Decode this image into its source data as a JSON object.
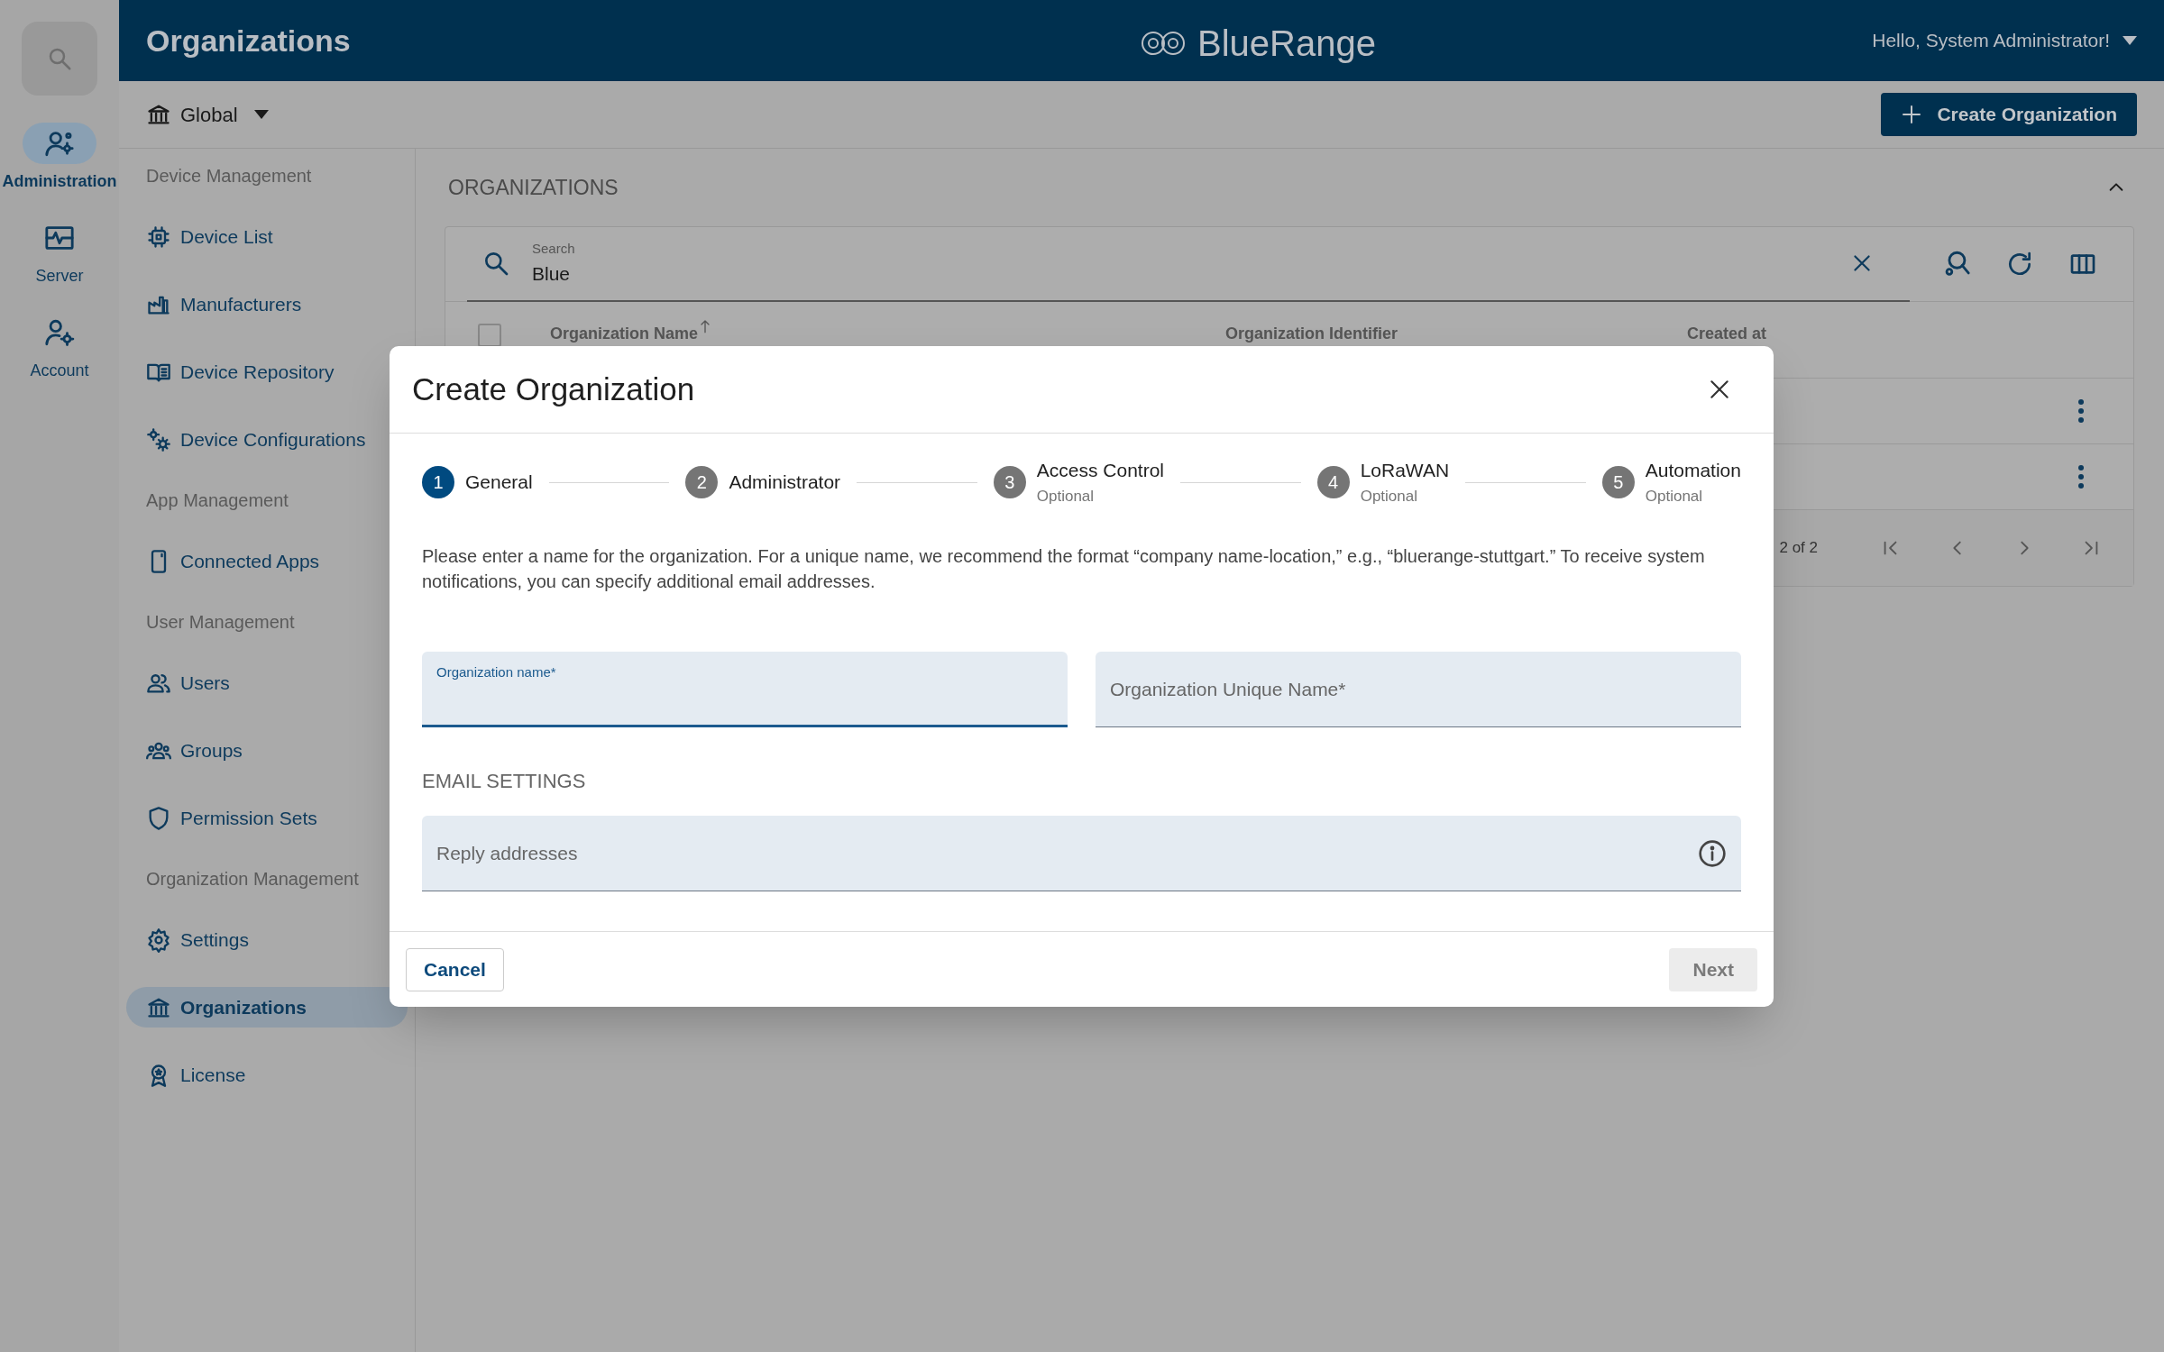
{
  "app_bar": {
    "title": "Organizations",
    "brand": "BlueRange",
    "greeting": "Hello, System Administrator!"
  },
  "rail": [
    {
      "label": "Administration",
      "selected": true
    },
    {
      "label": "Server",
      "selected": false
    },
    {
      "label": "Account",
      "selected": false
    }
  ],
  "scope_selector": "Global",
  "create_button": "Create Organization",
  "sidebar": [
    {
      "kind": "heading",
      "label": "Device Management"
    },
    {
      "kind": "item",
      "label": "Device List",
      "selected": false
    },
    {
      "kind": "item",
      "label": "Manufacturers",
      "selected": false
    },
    {
      "kind": "item",
      "label": "Device Repository",
      "selected": false
    },
    {
      "kind": "item",
      "label": "Device Configurations",
      "selected": false
    },
    {
      "kind": "heading",
      "label": "App Management"
    },
    {
      "kind": "item",
      "label": "Connected Apps",
      "selected": false
    },
    {
      "kind": "heading",
      "label": "User Management"
    },
    {
      "kind": "item",
      "label": "Users",
      "selected": false
    },
    {
      "kind": "item",
      "label": "Groups",
      "selected": false
    },
    {
      "kind": "item",
      "label": "Permission Sets",
      "selected": false
    },
    {
      "kind": "heading",
      "label": "Organization Management"
    },
    {
      "kind": "item",
      "label": "Settings",
      "selected": false
    },
    {
      "kind": "item",
      "label": "Organizations",
      "selected": true
    },
    {
      "kind": "item",
      "label": "License",
      "selected": false
    }
  ],
  "panel": {
    "title": "ORGANIZATIONS",
    "search": {
      "label": "Search",
      "value": "Blue"
    },
    "columns": [
      "Organization Name",
      "Organization Identifier",
      "Created at"
    ],
    "select_all": {
      "checked": false
    },
    "pagination": "2 of 2"
  },
  "dialog": {
    "title": "Create Organization",
    "steps": [
      {
        "number": "1",
        "label": "General",
        "selected": true
      },
      {
        "number": "2",
        "label": "Administrator",
        "selected": false
      },
      {
        "number": "3",
        "label": "Access Control",
        "sublabel": "Optional",
        "selected": false
      },
      {
        "number": "4",
        "label": "LoRaWAN",
        "sublabel": "Optional",
        "selected": false
      },
      {
        "number": "5",
        "label": "Automation",
        "sublabel": "Optional",
        "selected": false
      }
    ],
    "description": "Please enter a name for the organization. For a unique name, we recommend the format “company name-location,” e.g., “bluerange-stuttgart.” To receive system notifications, you can specify additional email addresses.",
    "fields": [
      {
        "label": "Organization name*",
        "focused": true
      },
      {
        "label": "Organization Unique Name*",
        "focused": false
      }
    ],
    "section": "EMAIL SETTINGS",
    "reply_field": {
      "placeholder": "Reply addresses"
    },
    "cancel": "Cancel",
    "next": {
      "label": "Next",
      "disabled": true
    }
  }
}
